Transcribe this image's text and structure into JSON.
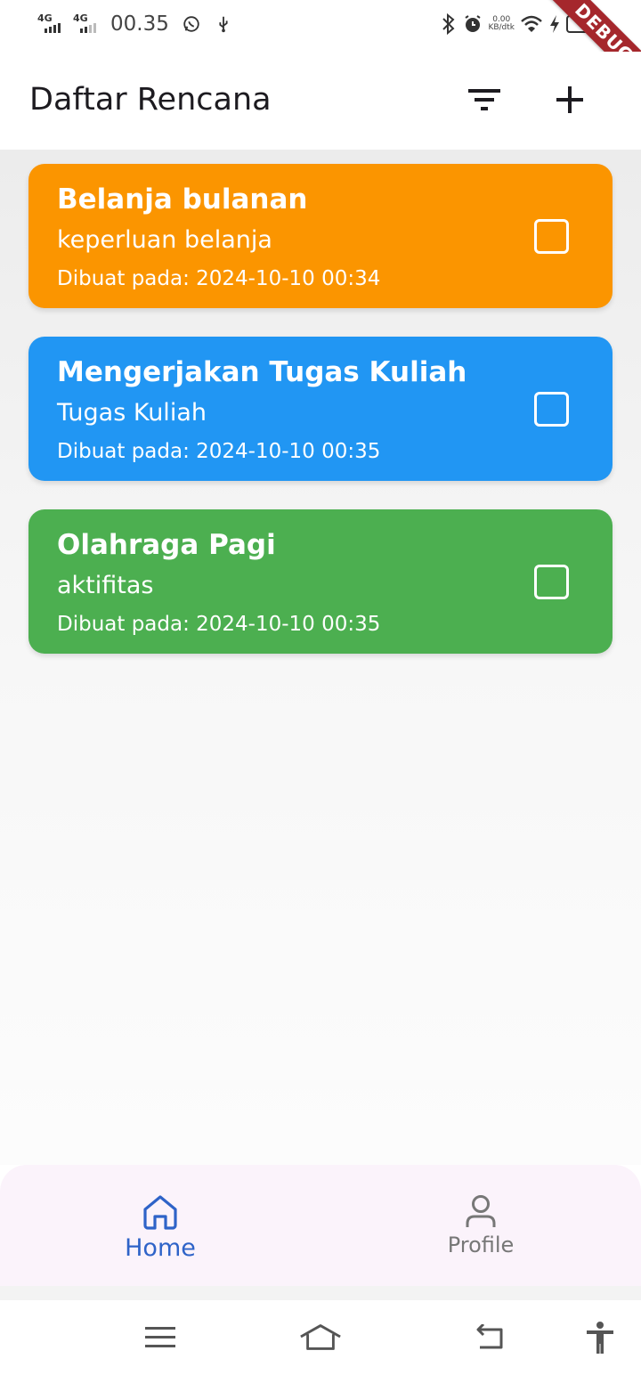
{
  "status_bar": {
    "signal1_label": "4G",
    "signal2_label": "4G",
    "time": "00.35",
    "speed_value": "0.00",
    "speed_unit": "KB/dtk",
    "debug_label": "DEBUG"
  },
  "app_bar": {
    "title": "Daftar Rencana",
    "filter_icon": "filter-icon",
    "add_icon": "plus-icon"
  },
  "plans": [
    {
      "title": "Belanja bulanan",
      "description": "keperluan belanja",
      "created": "Dibuat pada: 2024-10-10 00:34",
      "color": "#fb9500",
      "checked": false
    },
    {
      "title": "Mengerjakan Tugas Kuliah",
      "description": "Tugas Kuliah",
      "created": "Dibuat pada: 2024-10-10 00:35",
      "color": "#2196f3",
      "checked": false
    },
    {
      "title": "Olahraga Pagi",
      "description": "aktifitas",
      "created": "Dibuat pada: 2024-10-10 00:35",
      "color": "#4caf50",
      "checked": false
    }
  ],
  "bottom_nav": {
    "items": [
      {
        "label": "Home",
        "icon": "home-icon",
        "active": true
      },
      {
        "label": "Profile",
        "icon": "person-icon",
        "active": false
      }
    ],
    "active_color": "#2e63c8"
  },
  "system_nav": {
    "icons": [
      "menu-icon",
      "home-icon",
      "back-icon",
      "accessibility-icon"
    ]
  }
}
